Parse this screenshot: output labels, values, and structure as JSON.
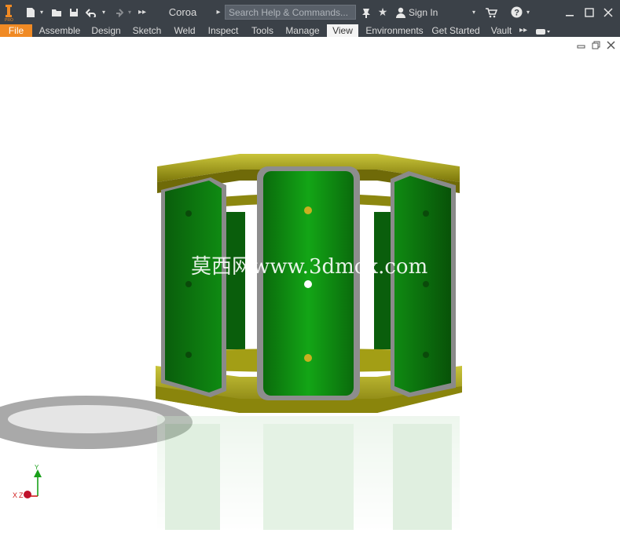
{
  "title_bar": {
    "document_name": "Coroa",
    "search_placeholder": "Search Help & Commands...",
    "sign_in": "Sign In"
  },
  "ribbon": {
    "tabs": [
      {
        "label": "File"
      },
      {
        "label": "Assemble"
      },
      {
        "label": "Design"
      },
      {
        "label": "Sketch"
      },
      {
        "label": "Weld"
      },
      {
        "label": "Inspect"
      },
      {
        "label": "Tools"
      },
      {
        "label": "Manage"
      },
      {
        "label": "View"
      },
      {
        "label": "Environments"
      },
      {
        "label": "Get Started"
      },
      {
        "label": "Vault"
      }
    ],
    "active_tab": "View"
  },
  "viewport": {
    "watermark": "莫西网www.3dmox.com",
    "axis_labels": {
      "y": "Y",
      "x": "X",
      "z": "Z"
    }
  },
  "colors": {
    "title_bg": "#3b4148",
    "file_tab": "#f08a24",
    "part_green": "#0f8a12",
    "part_yellow": "#a6a10f"
  }
}
